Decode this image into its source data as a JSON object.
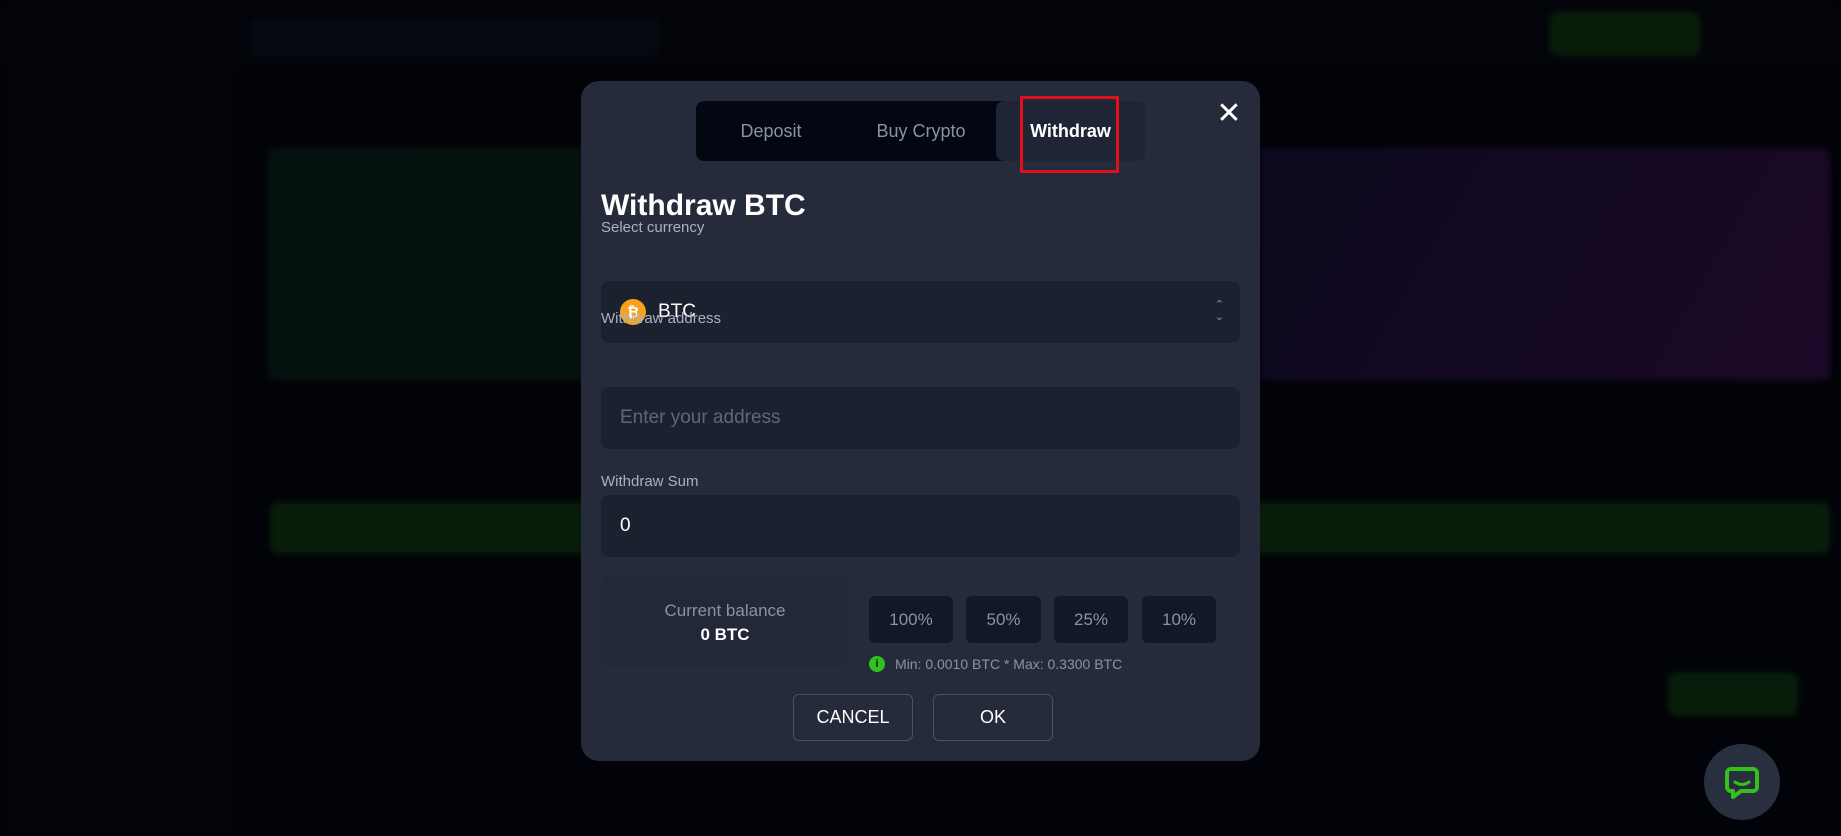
{
  "modal": {
    "tabs": [
      {
        "label": "Deposit"
      },
      {
        "label": "Buy Crypto"
      },
      {
        "label": "Withdraw",
        "active": true
      }
    ],
    "title": "Withdraw BTC",
    "currency": {
      "label": "Select currency",
      "value": "BTC",
      "icon": "bitcoin-icon",
      "icon_color": "#f7a21b"
    },
    "address": {
      "label": "Withdraw address",
      "placeholder": "Enter your address",
      "value": ""
    },
    "sum": {
      "label": "Withdraw Sum",
      "value": "0"
    },
    "balance": {
      "label": "Current balance",
      "value": "0 BTC"
    },
    "percent_buttons": [
      "100%",
      "50%",
      "25%",
      "10%"
    ],
    "limits": "Min: 0.0010 BTC * Max: 0.3300 BTC",
    "cancel_label": "CANCEL",
    "ok_label": "OK"
  },
  "colors": {
    "accent_green": "#33c11e",
    "highlight": "#e0101a"
  }
}
